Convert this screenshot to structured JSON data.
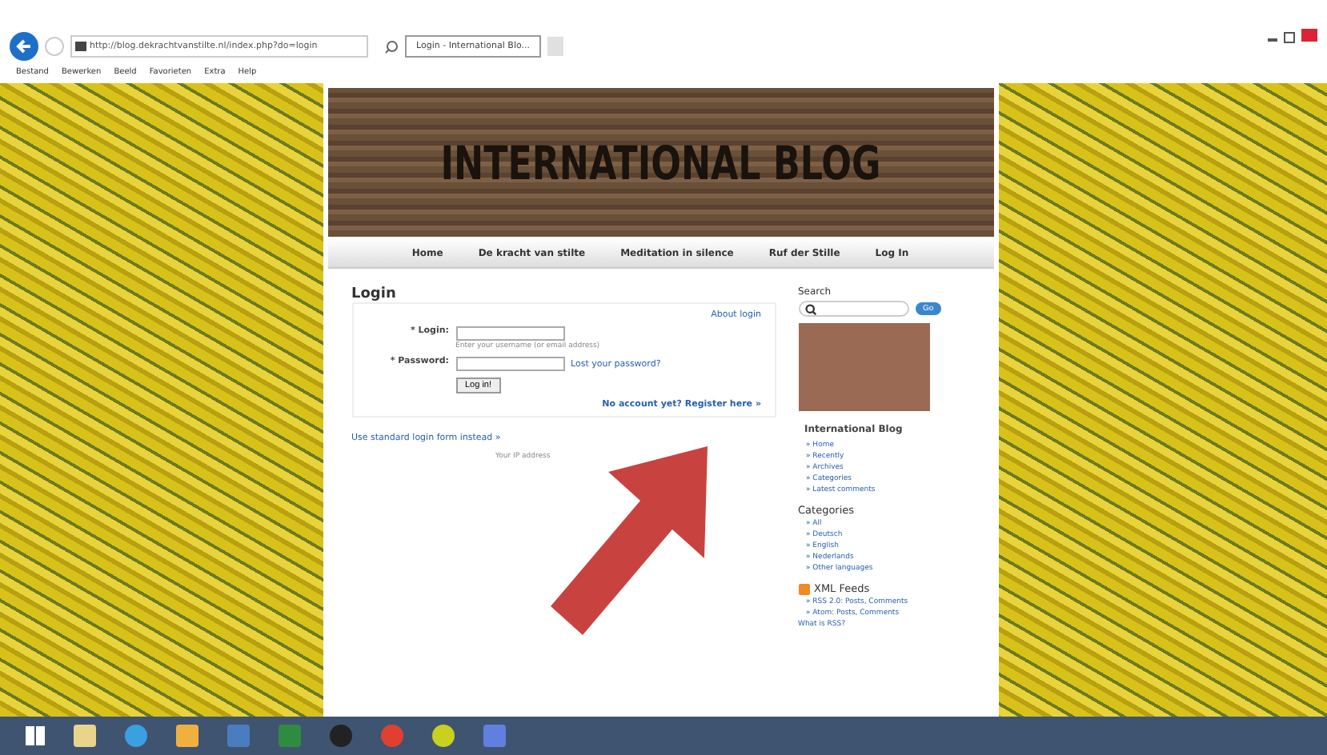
{
  "browser": {
    "address": "http://blog.dekrachtvanstilte.nl/index.php?do=login",
    "tabs": [
      {
        "label": "Login - International Blo...",
        "selected": true
      }
    ],
    "menu": [
      "Bestand",
      "Bewerken",
      "Beeld",
      "Favorieten",
      "Extra",
      "Help"
    ]
  },
  "site": {
    "title": "INTERNATIONAL BLOG",
    "nav": [
      {
        "label": "Home"
      },
      {
        "label": "De kracht van stilte"
      },
      {
        "label": "Meditation in silence"
      },
      {
        "label": "Ruf der Stille"
      },
      {
        "label": "Log In"
      }
    ]
  },
  "login": {
    "heading": "Login",
    "about": "About login",
    "fields": [
      {
        "label": "* Login:",
        "hint": "Enter your username (or email address)"
      },
      {
        "label": "* Password:",
        "link": "Lost your password?"
      }
    ],
    "button": "Log in!",
    "register": "No account yet? Register here »",
    "standard": "Use standard login form instead »",
    "ip_note": "Your IP address"
  },
  "sidebar": {
    "search_label": "Search",
    "search_button": "Go",
    "blog_heading": "International Blog",
    "blog_links": [
      "» Home",
      "» Recently",
      "» Archives",
      "» Categories",
      "» Latest comments"
    ],
    "categories_heading": "Categories",
    "categories": [
      "» All",
      "» Deutsch",
      "» English",
      "» Nederlands",
      "» Other languages"
    ],
    "feeds_heading": "XML Feeds",
    "feeds": [
      "» RSS 2.0: Posts, Comments",
      "» Atom: Posts, Comments"
    ],
    "rss_link": "What is RSS?"
  }
}
